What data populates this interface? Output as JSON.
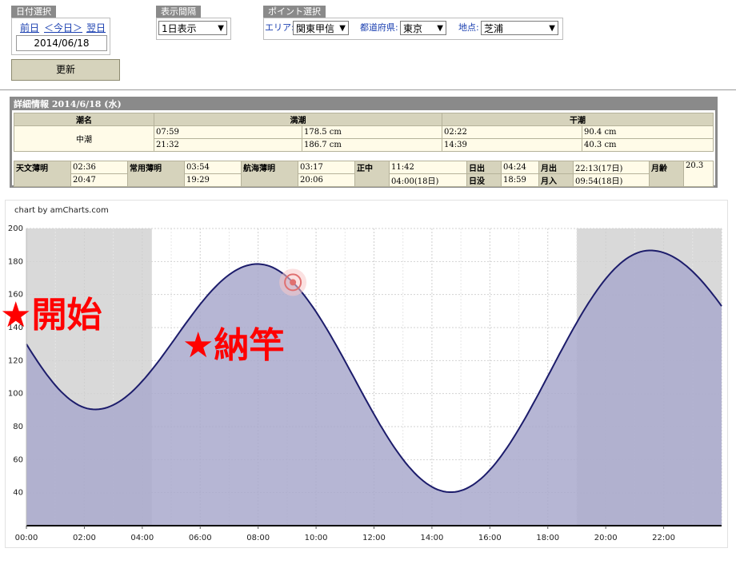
{
  "date_select": {
    "label": "日付選択",
    "prev": "前日",
    "today": "＜今日＞",
    "next": "翌日",
    "date": "2014/06/18"
  },
  "interval_select": {
    "label": "表示間隔",
    "value": "1日表示"
  },
  "point_select": {
    "label": "ポイント選択",
    "area_label": "エリア:",
    "area_value": "関東甲信",
    "pref_label": "都道府県:",
    "pref_value": "東京",
    "site_label": "地点:",
    "site_value": "芝浦"
  },
  "update_button": "更新",
  "detail": {
    "title": "詳細情報  2014/6/18 (水)",
    "tide_name_header": "潮名",
    "high_header": "満潮",
    "low_header": "干潮",
    "tide_name": "中潮",
    "high": [
      {
        "time": "07:59",
        "level": "178.5 cm"
      },
      {
        "time": "21:32",
        "level": "186.7 cm"
      }
    ],
    "low": [
      {
        "time": "02:22",
        "level": "90.4 cm"
      },
      {
        "time": "14:39",
        "level": "40.3 cm"
      }
    ],
    "astro": {
      "astro_twilight_label": "天文薄明",
      "astro_twilight": [
        "02:36",
        "20:47"
      ],
      "civil_twilight_label": "常用薄明",
      "civil_twilight": [
        "03:54",
        "19:29"
      ],
      "nautical_twilight_label": "航海薄明",
      "nautical_twilight": [
        "03:17",
        "20:06"
      ],
      "noon_label": "正中",
      "noon": [
        "11:42",
        "04:00(18日)"
      ],
      "sunrise_label": "日出",
      "sunrise": "04:24",
      "sunset_label": "日没",
      "sunset": "18:59",
      "moonrise_label": "月出",
      "moonrise": "22:13(17日)",
      "moonset_label": "月入",
      "moonset": "09:54(18日)",
      "moon_age_label": "月齢",
      "moon_age": "20.3"
    }
  },
  "chart_credit": "chart by amCharts.com",
  "overlay_texts": {
    "start": "★開始",
    "rod": "★納竿"
  },
  "colors": {
    "line": "#1c1c6b",
    "fill": "#a9a9cd",
    "night_band": "#d9d9d9",
    "overlay": "#ff0000",
    "header_gray": "#8a8a8a",
    "cell_beige": "#d6d3bc"
  },
  "chart_data": {
    "type": "area",
    "x_ticks": [
      "00:00",
      "02:00",
      "04:00",
      "06:00",
      "08:00",
      "10:00",
      "12:00",
      "14:00",
      "16:00",
      "18:00",
      "20:00",
      "22:00"
    ],
    "y_ticks": [
      40,
      60,
      80,
      100,
      120,
      140,
      160,
      180,
      200
    ],
    "ylim": [
      20,
      200
    ],
    "xlim_hours": [
      0,
      24
    ],
    "grid": true,
    "night_bands_hours": [
      [
        0,
        4.33
      ],
      [
        19.0,
        24
      ]
    ],
    "tide_extrema": [
      {
        "hour": 2.37,
        "value": 90.4
      },
      {
        "hour": 7.98,
        "value": 178.5
      },
      {
        "hour": 14.65,
        "value": 40.3
      },
      {
        "hour": 21.53,
        "value": 186.7
      }
    ],
    "start_value": 130,
    "end_value": 153,
    "cursor_hour": 9.2
  }
}
